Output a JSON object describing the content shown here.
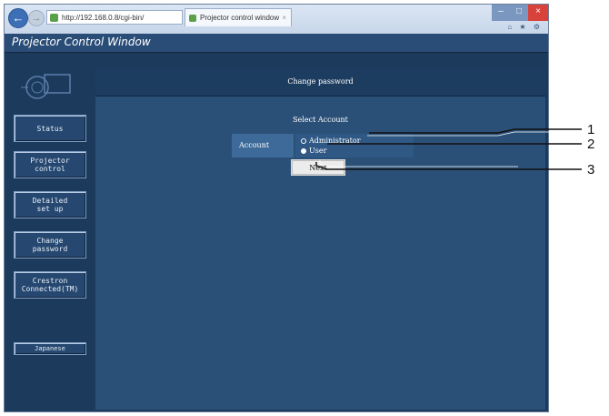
{
  "browser": {
    "address_text": "http://192.168.0.8/cgi-bin/",
    "tab_title": "Projector control window",
    "tab_close": "×",
    "back_glyph": "←",
    "forward_glyph": "→",
    "icons": [
      "back-icon",
      "forward-icon",
      "search-icon",
      "refresh-icon",
      "home-icon",
      "star-icon",
      "gear-icon"
    ],
    "window_controls": {
      "minimize": "–",
      "maximize": "□",
      "close": "×"
    },
    "tool_icons_text": "⌂ ★ ⚙"
  },
  "app": {
    "title": "Projector Control Window"
  },
  "sidebar": {
    "items": [
      {
        "label": "Status"
      },
      {
        "label": "Projector\ncontrol"
      },
      {
        "label": "Detailed\nset up"
      },
      {
        "label": "Change\npassword"
      },
      {
        "label": "Crestron\nConnected(TM)"
      }
    ],
    "language_button": "Japanese"
  },
  "content": {
    "header": "Change password",
    "select_account": "Select Account",
    "account_label": "Account",
    "options": [
      {
        "label": "Administrator",
        "checked": false
      },
      {
        "label": "User",
        "checked": true
      }
    ],
    "next_button": "Next"
  },
  "callouts": [
    "1",
    "2",
    "3"
  ],
  "colors": {
    "page_bg": "#1c3a5c",
    "content_bg": "#2b5078",
    "header_bg": "#1d3d60",
    "close_red": "#d9423a"
  }
}
